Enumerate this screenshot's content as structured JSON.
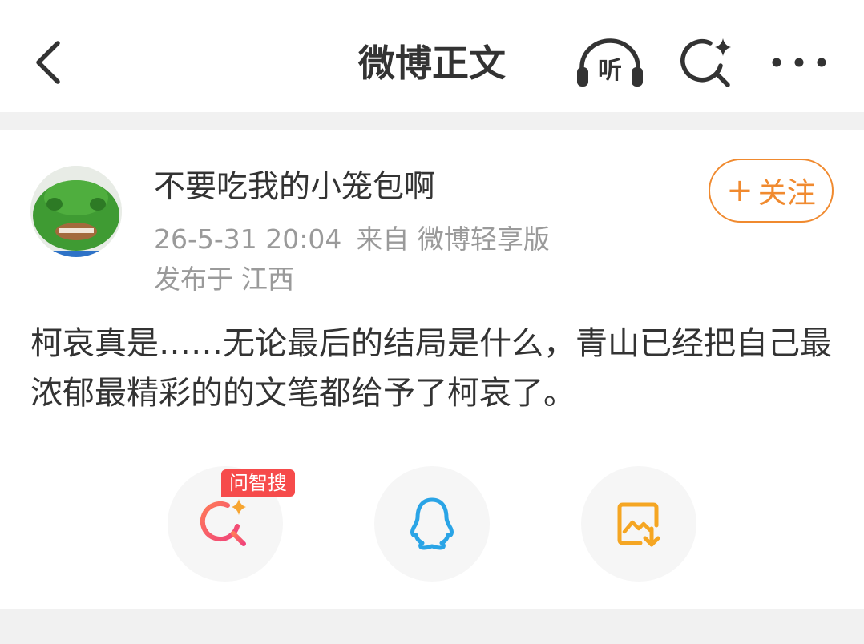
{
  "header": {
    "title": "微博正文",
    "listen_label": "听"
  },
  "post": {
    "username": "不要吃我的小笼包啊",
    "timestamp": "26-5-31 20:04",
    "source": "来自 微博轻享版",
    "location_prefix": "发布于",
    "location": "江西",
    "follow_label": "关注",
    "text": "柯哀真是……无论最后的结局是什么，青山已经把自己最浓郁最精彩的的文笔都给予了柯哀了。"
  },
  "actions": {
    "search_badge": "问智搜",
    "icons": [
      "ai-search-icon",
      "qq-icon",
      "save-image-icon"
    ]
  },
  "colors": {
    "accent_orange": "#f08a2f",
    "badge_red": "#f64b4b",
    "qq_blue": "#2aa4e6",
    "search_red": "#f5576c"
  }
}
